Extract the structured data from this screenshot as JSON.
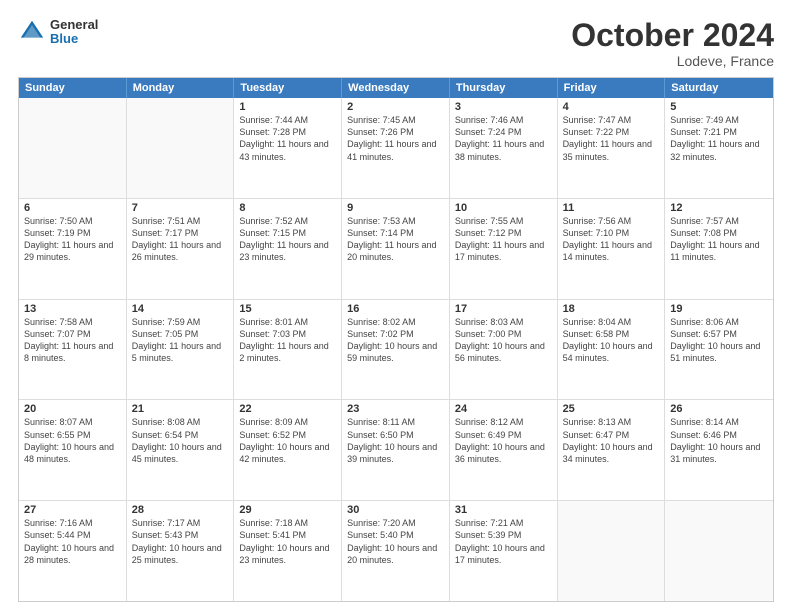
{
  "header": {
    "logo_general": "General",
    "logo_blue": "Blue",
    "title": "October 2024",
    "subtitle": "Lodeve, France"
  },
  "days_of_week": [
    "Sunday",
    "Monday",
    "Tuesday",
    "Wednesday",
    "Thursday",
    "Friday",
    "Saturday"
  ],
  "weeks": [
    [
      {
        "day": "",
        "empty": true
      },
      {
        "day": "",
        "empty": true
      },
      {
        "day": "1",
        "sunrise": "Sunrise: 7:44 AM",
        "sunset": "Sunset: 7:28 PM",
        "daylight": "Daylight: 11 hours and 43 minutes."
      },
      {
        "day": "2",
        "sunrise": "Sunrise: 7:45 AM",
        "sunset": "Sunset: 7:26 PM",
        "daylight": "Daylight: 11 hours and 41 minutes."
      },
      {
        "day": "3",
        "sunrise": "Sunrise: 7:46 AM",
        "sunset": "Sunset: 7:24 PM",
        "daylight": "Daylight: 11 hours and 38 minutes."
      },
      {
        "day": "4",
        "sunrise": "Sunrise: 7:47 AM",
        "sunset": "Sunset: 7:22 PM",
        "daylight": "Daylight: 11 hours and 35 minutes."
      },
      {
        "day": "5",
        "sunrise": "Sunrise: 7:49 AM",
        "sunset": "Sunset: 7:21 PM",
        "daylight": "Daylight: 11 hours and 32 minutes."
      }
    ],
    [
      {
        "day": "6",
        "sunrise": "Sunrise: 7:50 AM",
        "sunset": "Sunset: 7:19 PM",
        "daylight": "Daylight: 11 hours and 29 minutes."
      },
      {
        "day": "7",
        "sunrise": "Sunrise: 7:51 AM",
        "sunset": "Sunset: 7:17 PM",
        "daylight": "Daylight: 11 hours and 26 minutes."
      },
      {
        "day": "8",
        "sunrise": "Sunrise: 7:52 AM",
        "sunset": "Sunset: 7:15 PM",
        "daylight": "Daylight: 11 hours and 23 minutes."
      },
      {
        "day": "9",
        "sunrise": "Sunrise: 7:53 AM",
        "sunset": "Sunset: 7:14 PM",
        "daylight": "Daylight: 11 hours and 20 minutes."
      },
      {
        "day": "10",
        "sunrise": "Sunrise: 7:55 AM",
        "sunset": "Sunset: 7:12 PM",
        "daylight": "Daylight: 11 hours and 17 minutes."
      },
      {
        "day": "11",
        "sunrise": "Sunrise: 7:56 AM",
        "sunset": "Sunset: 7:10 PM",
        "daylight": "Daylight: 11 hours and 14 minutes."
      },
      {
        "day": "12",
        "sunrise": "Sunrise: 7:57 AM",
        "sunset": "Sunset: 7:08 PM",
        "daylight": "Daylight: 11 hours and 11 minutes."
      }
    ],
    [
      {
        "day": "13",
        "sunrise": "Sunrise: 7:58 AM",
        "sunset": "Sunset: 7:07 PM",
        "daylight": "Daylight: 11 hours and 8 minutes."
      },
      {
        "day": "14",
        "sunrise": "Sunrise: 7:59 AM",
        "sunset": "Sunset: 7:05 PM",
        "daylight": "Daylight: 11 hours and 5 minutes."
      },
      {
        "day": "15",
        "sunrise": "Sunrise: 8:01 AM",
        "sunset": "Sunset: 7:03 PM",
        "daylight": "Daylight: 11 hours and 2 minutes."
      },
      {
        "day": "16",
        "sunrise": "Sunrise: 8:02 AM",
        "sunset": "Sunset: 7:02 PM",
        "daylight": "Daylight: 10 hours and 59 minutes."
      },
      {
        "day": "17",
        "sunrise": "Sunrise: 8:03 AM",
        "sunset": "Sunset: 7:00 PM",
        "daylight": "Daylight: 10 hours and 56 minutes."
      },
      {
        "day": "18",
        "sunrise": "Sunrise: 8:04 AM",
        "sunset": "Sunset: 6:58 PM",
        "daylight": "Daylight: 10 hours and 54 minutes."
      },
      {
        "day": "19",
        "sunrise": "Sunrise: 8:06 AM",
        "sunset": "Sunset: 6:57 PM",
        "daylight": "Daylight: 10 hours and 51 minutes."
      }
    ],
    [
      {
        "day": "20",
        "sunrise": "Sunrise: 8:07 AM",
        "sunset": "Sunset: 6:55 PM",
        "daylight": "Daylight: 10 hours and 48 minutes."
      },
      {
        "day": "21",
        "sunrise": "Sunrise: 8:08 AM",
        "sunset": "Sunset: 6:54 PM",
        "daylight": "Daylight: 10 hours and 45 minutes."
      },
      {
        "day": "22",
        "sunrise": "Sunrise: 8:09 AM",
        "sunset": "Sunset: 6:52 PM",
        "daylight": "Daylight: 10 hours and 42 minutes."
      },
      {
        "day": "23",
        "sunrise": "Sunrise: 8:11 AM",
        "sunset": "Sunset: 6:50 PM",
        "daylight": "Daylight: 10 hours and 39 minutes."
      },
      {
        "day": "24",
        "sunrise": "Sunrise: 8:12 AM",
        "sunset": "Sunset: 6:49 PM",
        "daylight": "Daylight: 10 hours and 36 minutes."
      },
      {
        "day": "25",
        "sunrise": "Sunrise: 8:13 AM",
        "sunset": "Sunset: 6:47 PM",
        "daylight": "Daylight: 10 hours and 34 minutes."
      },
      {
        "day": "26",
        "sunrise": "Sunrise: 8:14 AM",
        "sunset": "Sunset: 6:46 PM",
        "daylight": "Daylight: 10 hours and 31 minutes."
      }
    ],
    [
      {
        "day": "27",
        "sunrise": "Sunrise: 7:16 AM",
        "sunset": "Sunset: 5:44 PM",
        "daylight": "Daylight: 10 hours and 28 minutes."
      },
      {
        "day": "28",
        "sunrise": "Sunrise: 7:17 AM",
        "sunset": "Sunset: 5:43 PM",
        "daylight": "Daylight: 10 hours and 25 minutes."
      },
      {
        "day": "29",
        "sunrise": "Sunrise: 7:18 AM",
        "sunset": "Sunset: 5:41 PM",
        "daylight": "Daylight: 10 hours and 23 minutes."
      },
      {
        "day": "30",
        "sunrise": "Sunrise: 7:20 AM",
        "sunset": "Sunset: 5:40 PM",
        "daylight": "Daylight: 10 hours and 20 minutes."
      },
      {
        "day": "31",
        "sunrise": "Sunrise: 7:21 AM",
        "sunset": "Sunset: 5:39 PM",
        "daylight": "Daylight: 10 hours and 17 minutes."
      },
      {
        "day": "",
        "empty": true
      },
      {
        "day": "",
        "empty": true
      }
    ]
  ]
}
